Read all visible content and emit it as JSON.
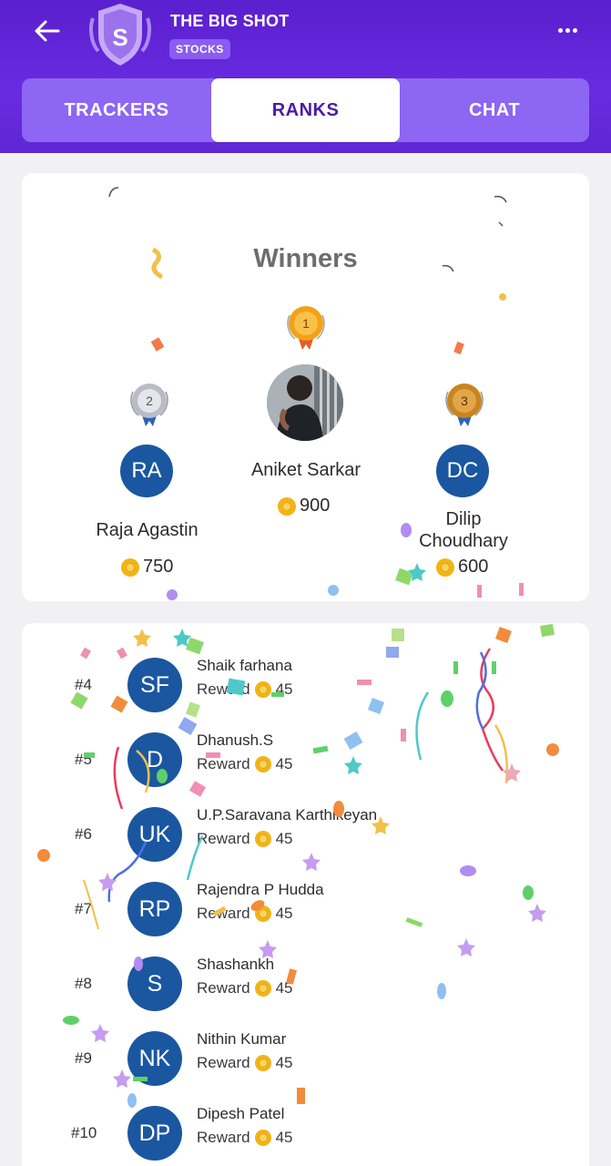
{
  "header": {
    "title": "THE BIG SHOT",
    "tag": "STOCKS",
    "badge_letter": "S"
  },
  "tabs": [
    {
      "label": "TRACKERS",
      "active": false
    },
    {
      "label": "RANKS",
      "active": true
    },
    {
      "label": "CHAT",
      "active": false
    }
  ],
  "winners": {
    "title": "Winners",
    "first": {
      "rank": "1",
      "name": "Aniket Sarkar",
      "points": "900"
    },
    "second": {
      "rank": "2",
      "initials": "RA",
      "name": "Raja  Agastin",
      "points": "750"
    },
    "third": {
      "rank": "3",
      "initials": "DC",
      "name": "Dilip Choudhary",
      "name_line1": "Dilip",
      "name_line2": "Choudhary",
      "points": "600"
    }
  },
  "ranks": {
    "reward_label": "Reward",
    "rows": [
      {
        "rank": "#4",
        "initials": "SF",
        "name": "Shaik farhana",
        "reward": "45"
      },
      {
        "rank": "#5",
        "initials": "D",
        "name": "Dhanush.S",
        "reward": "45"
      },
      {
        "rank": "#6",
        "initials": "UK",
        "name": "U.P.Saravana Karthikeyan",
        "reward": "45"
      },
      {
        "rank": "#7",
        "initials": "RP",
        "name": "Rajendra P Hudda",
        "reward": "45"
      },
      {
        "rank": "#8",
        "initials": "S",
        "name": "Shashankh",
        "reward": "45"
      },
      {
        "rank": "#9",
        "initials": "NK",
        "name": "Nithin Kumar",
        "reward": "45"
      },
      {
        "rank": "#10",
        "initials": "DP",
        "name": "Dipesh Patel",
        "reward": "45"
      }
    ]
  },
  "colors": {
    "header": "#5a1fcf",
    "tab_bar": "#8d66f3",
    "active_tab_text": "#4b1aa6",
    "avatar": "#1a57a0",
    "coin": "#f2b416"
  }
}
